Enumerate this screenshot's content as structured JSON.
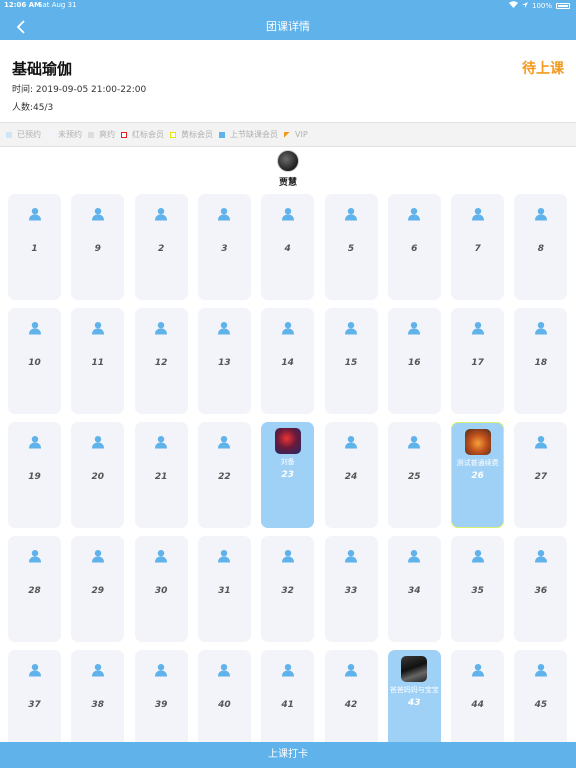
{
  "status_bar": {
    "time": "12:06 AM",
    "date": "Sat Aug 31",
    "battery": "100%"
  },
  "nav": {
    "back_icon": "chevron-left-icon",
    "title": "团课详情"
  },
  "class_info": {
    "name": "基础瑜伽",
    "status": "待上课",
    "time": "时间: 2019-09-05 21:00-22:00",
    "count": "人数:45/3"
  },
  "legend": [
    {
      "label": "已预约",
      "color": "#cfe6f8",
      "style": "fill"
    },
    {
      "label": "未预约",
      "color": "#f3f4f9",
      "style": "fill"
    },
    {
      "label": "爽约",
      "color": "#dddddd",
      "style": "fill"
    },
    {
      "label": "红标会员",
      "color": "#e02020",
      "style": "border"
    },
    {
      "label": "黄标会员",
      "color": "#e6e600",
      "style": "border"
    },
    {
      "label": "上节缺课会员",
      "color": "#5fb2ea",
      "style": "fill"
    },
    {
      "label": "VIP",
      "color": "#f39a1e",
      "style": "flag"
    }
  ],
  "instructor": {
    "name": "贾慧"
  },
  "seats": [
    {
      "num": "1"
    },
    {
      "num": "9"
    },
    {
      "num": "2"
    },
    {
      "num": "3"
    },
    {
      "num": "4"
    },
    {
      "num": "5"
    },
    {
      "num": "6"
    },
    {
      "num": "7"
    },
    {
      "num": "8"
    },
    {
      "num": "10"
    },
    {
      "num": "11"
    },
    {
      "num": "12"
    },
    {
      "num": "13"
    },
    {
      "num": "14"
    },
    {
      "num": "15"
    },
    {
      "num": "16"
    },
    {
      "num": "17"
    },
    {
      "num": "18"
    },
    {
      "num": "19"
    },
    {
      "num": "20"
    },
    {
      "num": "21"
    },
    {
      "num": "22"
    },
    {
      "num": "23",
      "member": "刘备",
      "booked": true,
      "photo": "red"
    },
    {
      "num": "24"
    },
    {
      "num": "25"
    },
    {
      "num": "26",
      "member": "测试普通续费",
      "booked": true,
      "yellow": true,
      "photo": "orange"
    },
    {
      "num": "27"
    },
    {
      "num": "28"
    },
    {
      "num": "29"
    },
    {
      "num": "30"
    },
    {
      "num": "31"
    },
    {
      "num": "32"
    },
    {
      "num": "33"
    },
    {
      "num": "34"
    },
    {
      "num": "35"
    },
    {
      "num": "36"
    },
    {
      "num": "37"
    },
    {
      "num": "38"
    },
    {
      "num": "39"
    },
    {
      "num": "40"
    },
    {
      "num": "41"
    },
    {
      "num": "42"
    },
    {
      "num": "43",
      "member": "爸爸妈妈与宝宝",
      "booked": true,
      "photo": "dark"
    },
    {
      "num": "44"
    },
    {
      "num": "45"
    }
  ],
  "bottom_button": {
    "label": "上课打卡"
  },
  "colors": {
    "primary": "#5fb2ea",
    "status": "#f39a1e",
    "booked": "#9fd0f5"
  }
}
